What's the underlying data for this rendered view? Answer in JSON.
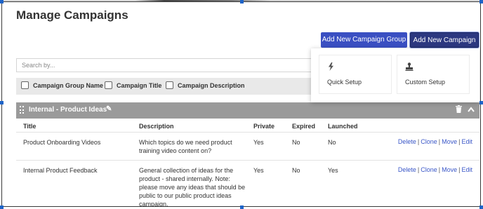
{
  "page": {
    "title": "Manage Campaigns"
  },
  "toolbar": {
    "add_group_label": "Add New Campaign Group",
    "add_campaign_label": "Add New Campaign"
  },
  "search": {
    "placeholder": "Search by..."
  },
  "filters": [
    {
      "label": "Campaign Group Name",
      "checked": false
    },
    {
      "label": "Campaign Title",
      "checked": false
    },
    {
      "label": "Campaign Description",
      "checked": false
    }
  ],
  "dropdown": {
    "options": [
      {
        "label": "Quick Setup",
        "icon": "lightning-icon"
      },
      {
        "label": "Custom Setup",
        "icon": "stamp-icon"
      }
    ]
  },
  "group": {
    "name": "Internal - Product Ideas",
    "icons": [
      "drag-handle-icon",
      "pencil-icon",
      "trash-icon",
      "chevron-up-icon"
    ]
  },
  "table": {
    "headers": [
      "Title",
      "Description",
      "Private",
      "Expired",
      "Launched"
    ],
    "rows": [
      {
        "title": "Product Onboarding Videos",
        "description": "Which topics do we need product training video content on?",
        "private": "Yes",
        "expired": "No",
        "launched": "No"
      },
      {
        "title": "Internal Product Feedback",
        "description": "General collection of ideas for the product - shared internally. Note: please move any ideas that should be public to our public product ideas campaign.",
        "private": "Yes",
        "expired": "No",
        "launched": "Yes"
      }
    ],
    "actions": [
      "Delete",
      "Clone",
      "Move",
      "Edit"
    ],
    "action_separator": "|"
  },
  "colors": {
    "primary_button": "#3a4fc2",
    "primary_button_dark": "#2c3880",
    "group_header": "#9a9a9a",
    "link": "#3a57c8",
    "filter_bar": "#e9e9e9"
  }
}
